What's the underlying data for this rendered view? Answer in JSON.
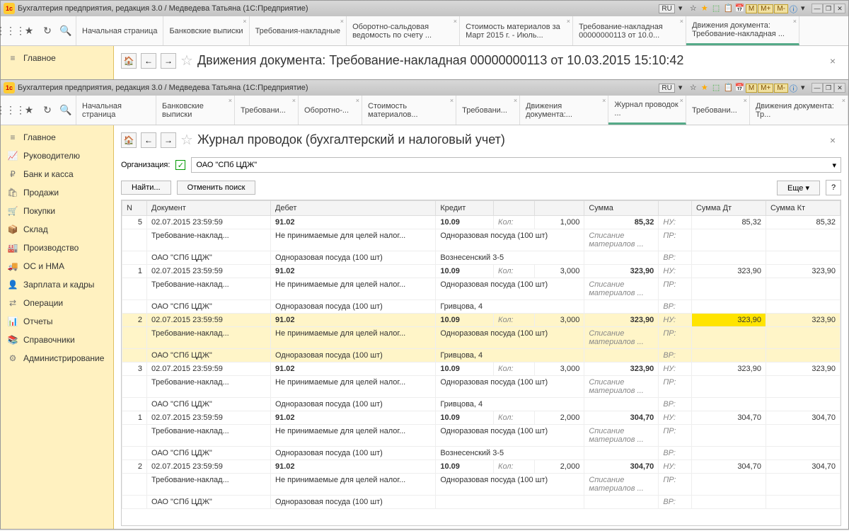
{
  "win1": {
    "title": "Бухгалтерия предприятия, редакция 3.0 / Медведева Татьяна  (1С:Предприятие)",
    "lang": "RU",
    "tabs": [
      "Начальная страница",
      "Банковские выписки",
      "Требования-накладные",
      "Оборотно-сальдовая ведомость по счету ...",
      "Стоимость материалов за Март 2015 г. - Июль...",
      "Требование-накладная 00000000113 от 10.0...",
      "Движения документа: Требование-накладная ..."
    ],
    "activeTab": 6,
    "sidebar": [
      "Главное"
    ],
    "pageTitle": "Движения документа: Требование-накладная 00000000113 от 10.03.2015 15:10:42"
  },
  "win2": {
    "title": "Бухгалтерия предприятия, редакция 3.0 / Медведева Татьяна  (1С:Предприятие)",
    "lang": "RU",
    "mLabels": [
      "M",
      "M+",
      "M-"
    ],
    "tabs": [
      "Начальная страница",
      "Банковские выписки",
      "Требовани...",
      "Оборотно-...",
      "Стоимость материалов...",
      "Требовани...",
      "Движения документа:...",
      "Журнал проводок ...",
      "Требовани...",
      "Движения документа: Тр..."
    ],
    "activeTab": 7,
    "sidebar": [
      {
        "icon": "≡",
        "label": "Главное"
      },
      {
        "icon": "📈",
        "label": "Руководителю"
      },
      {
        "icon": "₽",
        "label": "Банк и касса"
      },
      {
        "icon": "🛍",
        "label": "Продажи"
      },
      {
        "icon": "🛒",
        "label": "Покупки"
      },
      {
        "icon": "📦",
        "label": "Склад"
      },
      {
        "icon": "🏭",
        "label": "Производство"
      },
      {
        "icon": "🚚",
        "label": "ОС и НМА"
      },
      {
        "icon": "👤",
        "label": "Зарплата и кадры"
      },
      {
        "icon": "⇄",
        "label": "Операции"
      },
      {
        "icon": "📊",
        "label": "Отчеты"
      },
      {
        "icon": "📚",
        "label": "Справочники"
      },
      {
        "icon": "⚙",
        "label": "Администрирование"
      }
    ],
    "pageTitle": "Журнал проводок (бухгалтерский и налоговый учет)",
    "orgLabel": "Организация:",
    "orgValue": "ОАО \"СПб ЦДЖ\"",
    "btnFind": "Найти...",
    "btnCancel": "Отменить поиск",
    "btnMore": "Еще",
    "cols": [
      "N",
      "Документ",
      "Дебет",
      "Кредит",
      "Сумма",
      "Сумма Дт",
      "Сумма Кт"
    ],
    "rows": [
      {
        "n": "5",
        "date": "02.07.2015 23:59:59",
        "doc": "Требование-наклад...",
        "org": "ОАО \"СПб ЦДЖ\"",
        "deb1": "91.02",
        "deb2": "Не принимаемые для целей налог...",
        "deb3": "Одноразовая посуда (100 шт)",
        "kred1": "10.09",
        "kol": "Кол:",
        "qty": "1,000",
        "kred2": "Одноразовая посуда (100 шт)",
        "kred3": "Вознесенский 3-5",
        "sum": "85,32",
        "sum2": "Списание материалов ...",
        "nu": "НУ:",
        "pr": "ПР:",
        "vr": "ВР:",
        "dt": "85,32",
        "kt": "85,32",
        "hl": false
      },
      {
        "n": "1",
        "date": "02.07.2015 23:59:59",
        "doc": "Требование-наклад...",
        "org": "ОАО \"СПб ЦДЖ\"",
        "deb1": "91.02",
        "deb2": "Не принимаемые для целей налог...",
        "deb3": "Одноразовая посуда (100 шт)",
        "kred1": "10.09",
        "kol": "Кол:",
        "qty": "3,000",
        "kred2": "Одноразовая посуда (100 шт)",
        "kred3": "Гривцова, 4",
        "sum": "323,90",
        "sum2": "Списание материалов ...",
        "nu": "НУ:",
        "pr": "ПР:",
        "vr": "ВР:",
        "dt": "323,90",
        "kt": "323,90",
        "hl": false
      },
      {
        "n": "2",
        "date": "02.07.2015 23:59:59",
        "doc": "Требование-наклад...",
        "org": "ОАО \"СПб ЦДЖ\"",
        "deb1": "91.02",
        "deb2": "Не принимаемые для целей налог...",
        "deb3": "Одноразовая посуда (100 шт)",
        "kred1": "10.09",
        "kol": "Кол:",
        "qty": "3,000",
        "kred2": "Одноразовая посуда (100 шт)",
        "kred3": "Гривцова, 4",
        "sum": "323,90",
        "sum2": "Списание материалов ...",
        "nu": "НУ:",
        "pr": "ПР:",
        "vr": "ВР:",
        "dt": "323,90",
        "kt": "323,90",
        "hl": true
      },
      {
        "n": "3",
        "date": "02.07.2015 23:59:59",
        "doc": "Требование-наклад...",
        "org": "ОАО \"СПб ЦДЖ\"",
        "deb1": "91.02",
        "deb2": "Не принимаемые для целей налог...",
        "deb3": "Одноразовая посуда (100 шт)",
        "kred1": "10.09",
        "kol": "Кол:",
        "qty": "3,000",
        "kred2": "Одноразовая посуда (100 шт)",
        "kred3": "Гривцова, 4",
        "sum": "323,90",
        "sum2": "Списание материалов ...",
        "nu": "НУ:",
        "pr": "ПР:",
        "vr": "ВР:",
        "dt": "323,90",
        "kt": "323,90",
        "hl": false
      },
      {
        "n": "1",
        "date": "02.07.2015 23:59:59",
        "doc": "Требование-наклад...",
        "org": "ОАО \"СПб ЦДЖ\"",
        "deb1": "91.02",
        "deb2": "Не принимаемые для целей налог...",
        "deb3": "Одноразовая посуда (100 шт)",
        "kred1": "10.09",
        "kol": "Кол:",
        "qty": "2,000",
        "kred2": "Одноразовая посуда (100 шт)",
        "kred3": "Вознесенский 3-5",
        "sum": "304,70",
        "sum2": "Списание материалов ...",
        "nu": "НУ:",
        "pr": "ПР:",
        "vr": "ВР:",
        "dt": "304,70",
        "kt": "304,70",
        "hl": false
      },
      {
        "n": "2",
        "date": "02.07.2015 23:59:59",
        "doc": "Требование-наклад...",
        "org": "ОАО \"СПб ЦДЖ\"",
        "deb1": "91.02",
        "deb2": "Не принимаемые для целей налог...",
        "deb3": "Одноразовая посуда (100 шт)",
        "kred1": "10.09",
        "kol": "Кол:",
        "qty": "2,000",
        "kred2": "Одноразовая посуда (100 шт)",
        "kred3": "",
        "sum": "304,70",
        "sum2": "Списание материалов ...",
        "nu": "НУ:",
        "pr": "ПР:",
        "vr": "ВР:",
        "dt": "304,70",
        "kt": "304,70",
        "hl": false
      }
    ]
  }
}
